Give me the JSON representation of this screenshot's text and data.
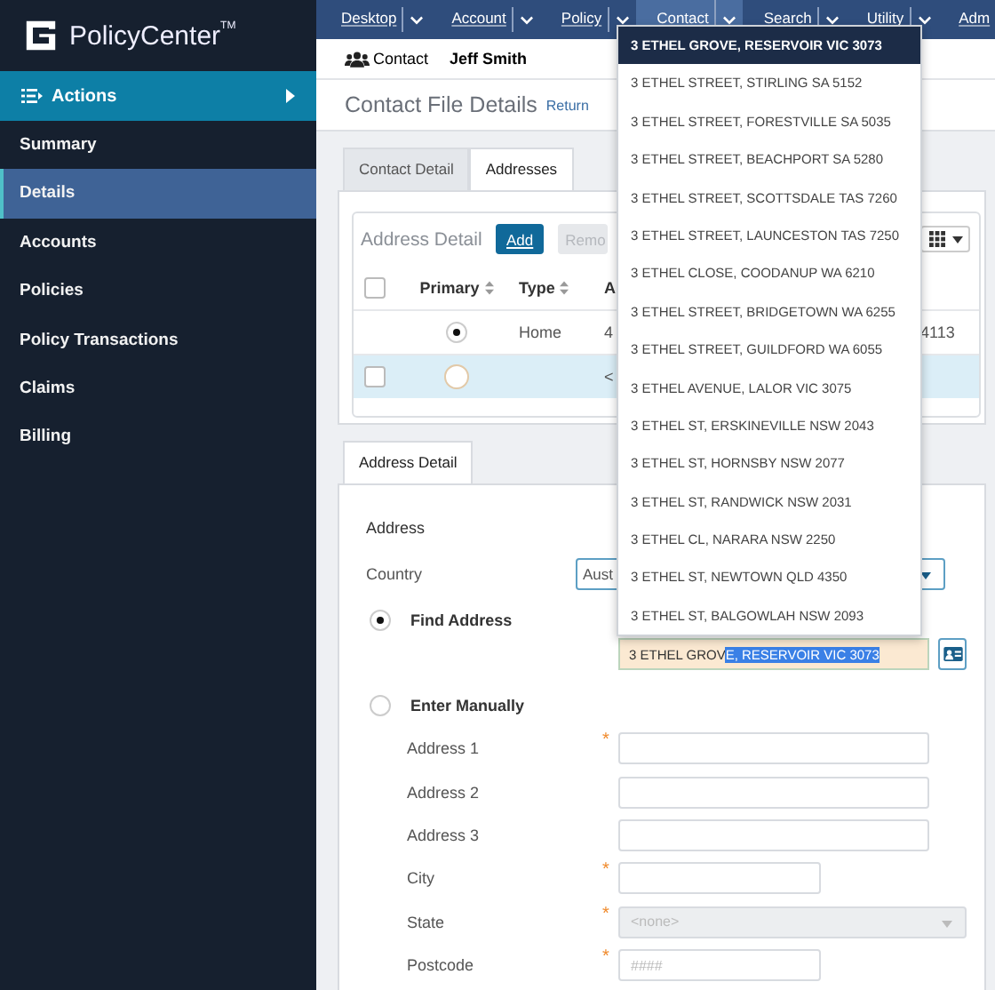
{
  "app": {
    "name": "PolicyCenter",
    "trademark": "TM"
  },
  "sidebar": {
    "actions": {
      "label": "Actions"
    },
    "items": [
      {
        "label": "Summary",
        "selected": false
      },
      {
        "label": "Details",
        "selected": true
      },
      {
        "label": "Accounts",
        "selected": false
      },
      {
        "label": "Policies",
        "selected": false
      },
      {
        "label": "Policy Transactions",
        "selected": false
      },
      {
        "label": "Claims",
        "selected": false
      },
      {
        "label": "Billing",
        "selected": false
      }
    ]
  },
  "top_nav": [
    {
      "label": "Desktop",
      "selected": false
    },
    {
      "label": "Account",
      "selected": false
    },
    {
      "label": "Policy",
      "selected": false
    },
    {
      "label": "Contact",
      "selected": true
    },
    {
      "label": "Search",
      "selected": false
    },
    {
      "label": "Utility",
      "selected": false
    },
    {
      "label": "Adm",
      "selected": false
    }
  ],
  "contact_bar": {
    "label": "Contact",
    "name": "Jeff Smith"
  },
  "page": {
    "title": "Contact File Details",
    "link": "Return"
  },
  "tabs": [
    {
      "label": "Contact Detail",
      "selected": false
    },
    {
      "label": "Addresses",
      "selected": true
    }
  ],
  "address_list": {
    "title": "Address Detail",
    "buttons": [
      {
        "label": "Add",
        "disabled": false
      },
      {
        "label": "Remo",
        "disabled": true
      }
    ],
    "select_all": {
      "checked": false
    },
    "columns": [
      "Primary",
      "Type",
      "A"
    ],
    "rows": [
      {
        "primary": true,
        "selected": false,
        "type": "Home",
        "address": "4",
        "column_5": "4113"
      },
      {
        "checkbox": {
          "checked": false
        },
        "primary": false,
        "selected": true,
        "address": "<"
      }
    ]
  },
  "detail_tabs": [
    {
      "label": "Address Detail",
      "selected": true
    }
  ],
  "address_form": {
    "section": "Address",
    "country": {
      "label": "Country",
      "value": "Aust"
    },
    "modes": [
      {
        "label": "Find Address",
        "selected": true
      },
      {
        "label": "Enter Manually",
        "selected": false
      }
    ],
    "search": {
      "value": "3 ETHEL GROV",
      "selected_text": "E, RESERVOIR VIC 3073"
    },
    "fields": [
      {
        "label": "Address 1",
        "required_mark": "*",
        "kind": "text"
      },
      {
        "label": "Address 2",
        "kind": "text"
      },
      {
        "label": "Address 3",
        "kind": "text"
      },
      {
        "label": "City",
        "required_mark": "*",
        "kind": "short"
      },
      {
        "label": "State",
        "required_mark": "*",
        "kind": "select",
        "value": "<none>",
        "disabled": true
      },
      {
        "label": "Postcode",
        "required_mark": "*",
        "kind": "short",
        "placeholder": "####"
      }
    ]
  },
  "suggestions": [
    {
      "label": "3 ETHEL GROVE, RESERVOIR VIC 3073",
      "selected": true
    },
    {
      "label": "3 ETHEL STREET, STIRLING SA 5152",
      "selected": false
    },
    {
      "label": "3 ETHEL STREET, FORESTVILLE SA 5035",
      "selected": false
    },
    {
      "label": "3 ETHEL STREET, BEACHPORT SA 5280",
      "selected": false
    },
    {
      "label": "3 ETHEL STREET, SCOTTSDALE TAS 7260",
      "selected": false
    },
    {
      "label": "3 ETHEL STREET, LAUNCESTON TAS 7250",
      "selected": false
    },
    {
      "label": "3 ETHEL CLOSE, COODANUP WA 6210",
      "selected": false
    },
    {
      "label": "3 ETHEL STREET, BRIDGETOWN WA 6255",
      "selected": false
    },
    {
      "label": "3 ETHEL STREET, GUILDFORD WA 6055",
      "selected": false
    },
    {
      "label": "3 ETHEL AVENUE, LALOR VIC 3075",
      "selected": false
    },
    {
      "label": "3 ETHEL ST, ERSKINEVILLE NSW 2043",
      "selected": false
    },
    {
      "label": "3 ETHEL ST, HORNSBY NSW 2077",
      "selected": false
    },
    {
      "label": "3 ETHEL ST, RANDWICK NSW 2031",
      "selected": false
    },
    {
      "label": "3 ETHEL CL, NARARA NSW 2250",
      "selected": false
    },
    {
      "label": "3 ETHEL ST, NEWTOWN QLD 4350",
      "selected": false
    },
    {
      "label": "3 ETHEL ST, BALGOWLAH NSW 2093",
      "selected": false
    }
  ]
}
